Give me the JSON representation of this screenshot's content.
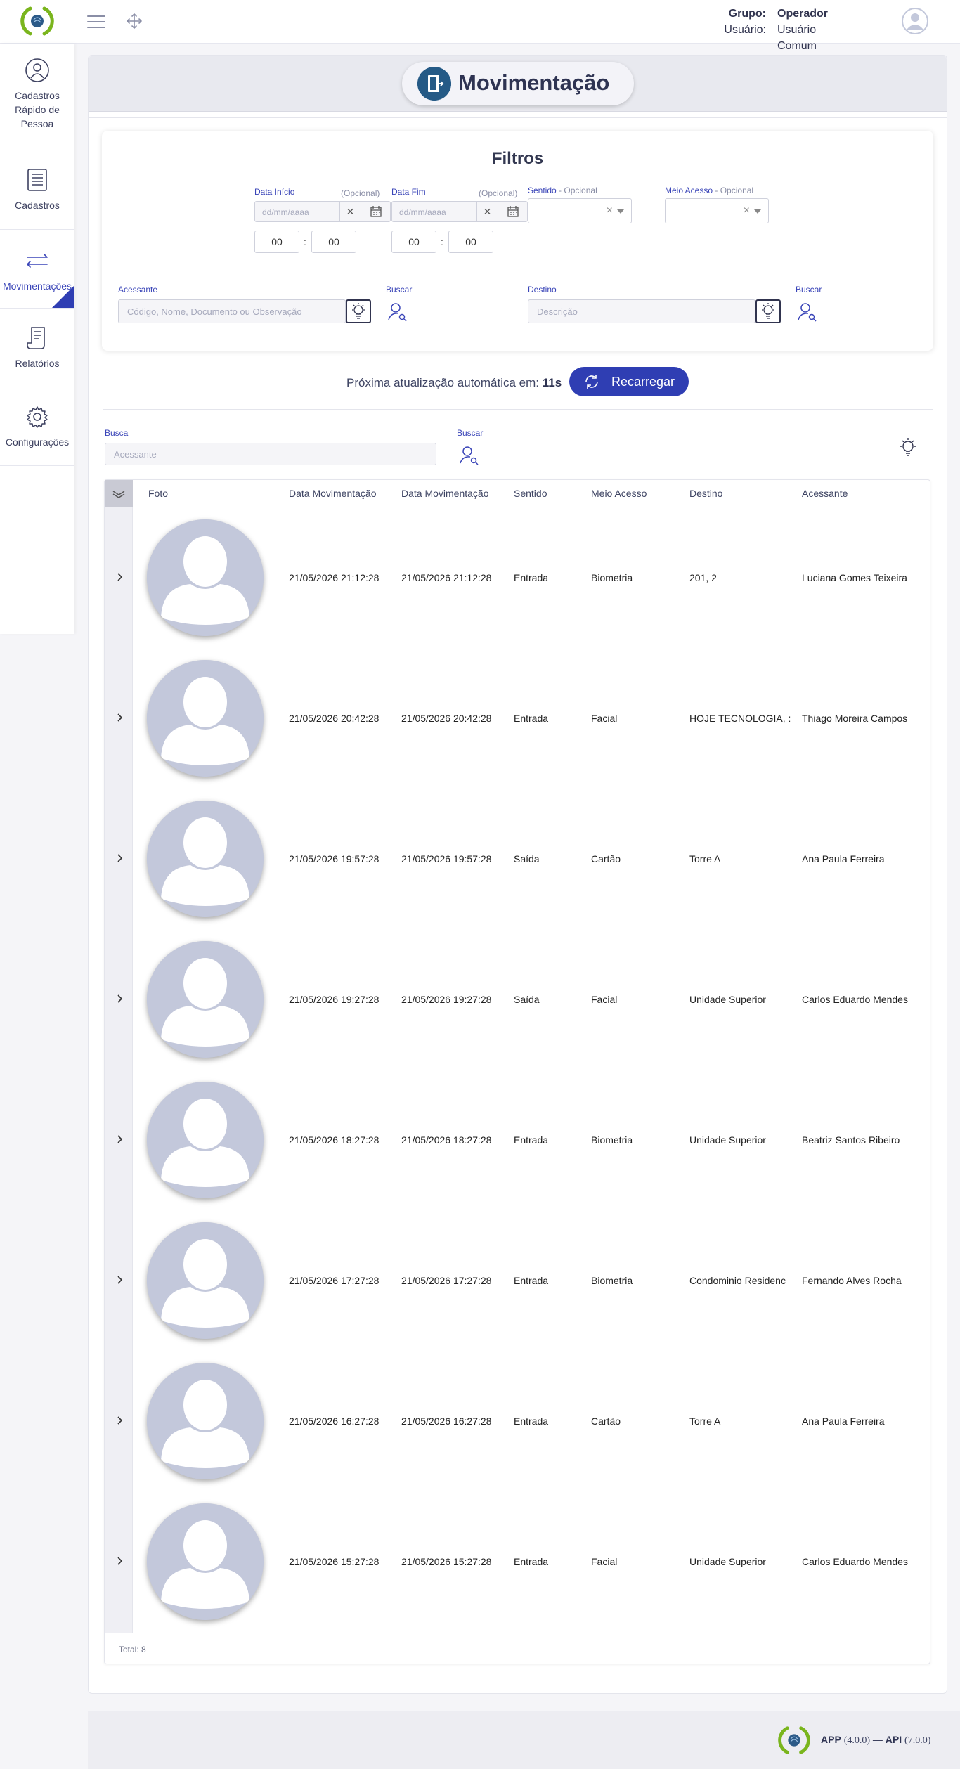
{
  "header": {
    "grupo_label": "Grupo:",
    "grupo_value": "Operador",
    "usuario_label": "Usuário:",
    "usuario_value": "Usuário Comum"
  },
  "sidebar": {
    "items": [
      {
        "label": "Cadastros Rápido de Pessoa",
        "icon": "user-circle-icon"
      },
      {
        "label": "Cadastros",
        "icon": "list-document-icon"
      },
      {
        "label": "Movimentações",
        "icon": "arrows-exchange-icon",
        "active": true
      },
      {
        "label": "Relatórios",
        "icon": "report-icon"
      },
      {
        "label": "Configurações",
        "icon": "gear-icon"
      }
    ]
  },
  "page": {
    "title": "Movimentação"
  },
  "filters": {
    "title": "Filtros",
    "data_inicio_label": "Data Início",
    "data_inicio_opt": "(Opcional)",
    "data_inicio_placeholder": "dd/mm/aaaa",
    "data_fim_label": "Data Fim",
    "data_fim_opt": "(Opcional)",
    "data_fim_placeholder": "dd/mm/aaaa",
    "hour_start": "00",
    "min_start": "00",
    "hour_end": "00",
    "min_end": "00",
    "sentido_label": "Sentido",
    "sentido_opt": "- Opcional",
    "meio_label": "Meio Acesso",
    "meio_opt": "- Opcional",
    "acessante_label": "Acessante",
    "acessante_placeholder": "Código, Nome, Documento ou Observação",
    "buscar_label": "Buscar",
    "destino_label": "Destino",
    "destino_placeholder": "Descrição",
    "buscar2_label": "Buscar"
  },
  "refresh": {
    "text": "Próxima atualização automática em:",
    "seconds": "11s",
    "button": "Recarregar"
  },
  "search": {
    "label": "Busca",
    "placeholder": "Acessante",
    "buscar_label": "Buscar"
  },
  "table": {
    "columns": [
      "Foto",
      "Data Movimentação",
      "Data Movimentação",
      "Sentido",
      "Meio Acesso",
      "Destino",
      "Acessante"
    ],
    "rows": [
      {
        "d1": "21/05/2026 21:12:28",
        "d2": "21/05/2026 21:12:28",
        "sentido": "Entrada",
        "meio": "Biometria",
        "destino": "201, 2",
        "acessante": "Luciana Gomes Teixeira"
      },
      {
        "d1": "21/05/2026 20:42:28",
        "d2": "21/05/2026 20:42:28",
        "sentido": "Entrada",
        "meio": "Facial",
        "destino": "HOJE TECNOLOGIA, :",
        "acessante": "Thiago Moreira Campos"
      },
      {
        "d1": "21/05/2026 19:57:28",
        "d2": "21/05/2026 19:57:28",
        "sentido": "Saída",
        "meio": "Cartão",
        "destino": "Torre A",
        "acessante": "Ana Paula Ferreira"
      },
      {
        "d1": "21/05/2026 19:27:28",
        "d2": "21/05/2026 19:27:28",
        "sentido": "Saída",
        "meio": "Facial",
        "destino": "Unidade Superior",
        "acessante": "Carlos Eduardo Mendes"
      },
      {
        "d1": "21/05/2026 18:27:28",
        "d2": "21/05/2026 18:27:28",
        "sentido": "Entrada",
        "meio": "Biometria",
        "destino": "Unidade Superior",
        "acessante": "Beatriz Santos Ribeiro"
      },
      {
        "d1": "21/05/2026 17:27:28",
        "d2": "21/05/2026 17:27:28",
        "sentido": "Entrada",
        "meio": "Biometria",
        "destino": "Condominio Residenc",
        "acessante": "Fernando Alves Rocha"
      },
      {
        "d1": "21/05/2026 16:27:28",
        "d2": "21/05/2026 16:27:28",
        "sentido": "Entrada",
        "meio": "Cartão",
        "destino": "Torre A",
        "acessante": "Ana Paula Ferreira"
      },
      {
        "d1": "21/05/2026 15:27:28",
        "d2": "21/05/2026 15:27:28",
        "sentido": "Entrada",
        "meio": "Facial",
        "destino": "Unidade Superior",
        "acessante": "Carlos Eduardo Mendes"
      }
    ],
    "total": "Total: 8"
  },
  "footer": {
    "app": "APP",
    "app_version": "(4.0.0)",
    "separator": "—",
    "api": "API",
    "api_version": "(7.0.0)"
  },
  "colors": {
    "primary": "#2f3eb3",
    "logo_green": "#7ab51d",
    "avatar_placeholder": "#c3c8db"
  }
}
